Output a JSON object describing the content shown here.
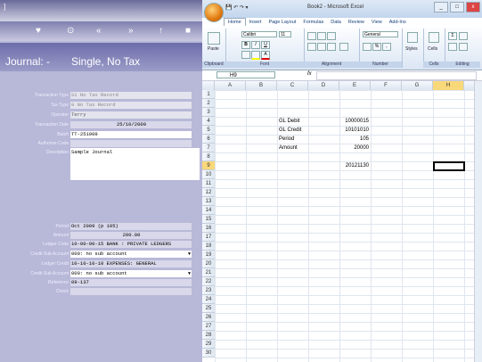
{
  "left_app": {
    "window_title": "]",
    "nav_glyphs": [
      "♥",
      "⊙",
      "«",
      "»",
      "↑",
      "■"
    ],
    "heading_prefix": "Journal: -",
    "heading_title": "Single, No Tax",
    "fields": [
      {
        "label": "Transaction Type",
        "value": "S1 No Tax Record"
      },
      {
        "label": "Tax Type",
        "value": "0 No Tax Record"
      },
      {
        "label": "Operator",
        "value": "Terry"
      },
      {
        "label": "Transaction Date",
        "value": "25/10/2009"
      },
      {
        "label": "Batch",
        "value": "TT-251009"
      },
      {
        "label": "Authorise Code",
        "value": ""
      },
      {
        "label": "Description",
        "value": "Sample Journal"
      },
      {
        "label": "Period",
        "value": "Oct 2009 (p 105)"
      },
      {
        "label": "Amount",
        "value": "200.00"
      },
      {
        "label": "Ledger Code",
        "value": "10-00-00-15 BANK : PRIVATE LEDGERS"
      },
      {
        "label": "Credit Sub Account",
        "value": "000: no sub account"
      },
      {
        "label": "Ledger Credit",
        "value": "10-10-10-10 EXPENSES: GENERAL"
      },
      {
        "label": "Credit Sub Account",
        "value": "000: no sub account"
      },
      {
        "label": "Reference",
        "value": "09-137"
      },
      {
        "label": "Check",
        "value": ""
      }
    ]
  },
  "excel": {
    "title": "Book2 - Microsoft Excel",
    "qat_glyphs": "💾 ↶ ↷ ▾",
    "window_controls": [
      "_",
      "□",
      "x"
    ],
    "tabs": [
      "Home",
      "Insert",
      "Page Layout",
      "Formulas",
      "Data",
      "Review",
      "View",
      "Add-Ins"
    ],
    "ribbon": {
      "paste_label": "Paste",
      "font_name": "Calibri",
      "font_size": "11",
      "number_format": "General",
      "group_labels": [
        "Clipboard",
        "Font",
        "Alignment",
        "Number",
        "Styles",
        "Cells",
        "Editing"
      ],
      "styles_label": "Styles",
      "cells_label": "Cells"
    },
    "name_box": "H9",
    "fx": "fx",
    "columns": [
      "A",
      "B",
      "C",
      "D",
      "E",
      "F",
      "G",
      "H",
      "I"
    ],
    "rows": [
      "1",
      "2",
      "3",
      "4",
      "5",
      "6",
      "7",
      "8",
      "9",
      "10",
      "11",
      "12",
      "13",
      "14",
      "15",
      "16",
      "17",
      "18",
      "19",
      "20",
      "21",
      "22",
      "23",
      "24",
      "25",
      "26",
      "27",
      "28",
      "29",
      "30"
    ],
    "selected_cell": "H9",
    "cells": [
      {
        "ref": "C4",
        "value": "GL Debit"
      },
      {
        "ref": "E4",
        "value": "10000015"
      },
      {
        "ref": "C5",
        "value": "GL Credit"
      },
      {
        "ref": "E5",
        "value": "10101010"
      },
      {
        "ref": "C6",
        "value": "Period"
      },
      {
        "ref": "E6",
        "value": "105"
      },
      {
        "ref": "C7",
        "value": "Amount"
      },
      {
        "ref": "E7",
        "value": "20000"
      },
      {
        "ref": "E9",
        "value": "20121130"
      }
    ]
  }
}
